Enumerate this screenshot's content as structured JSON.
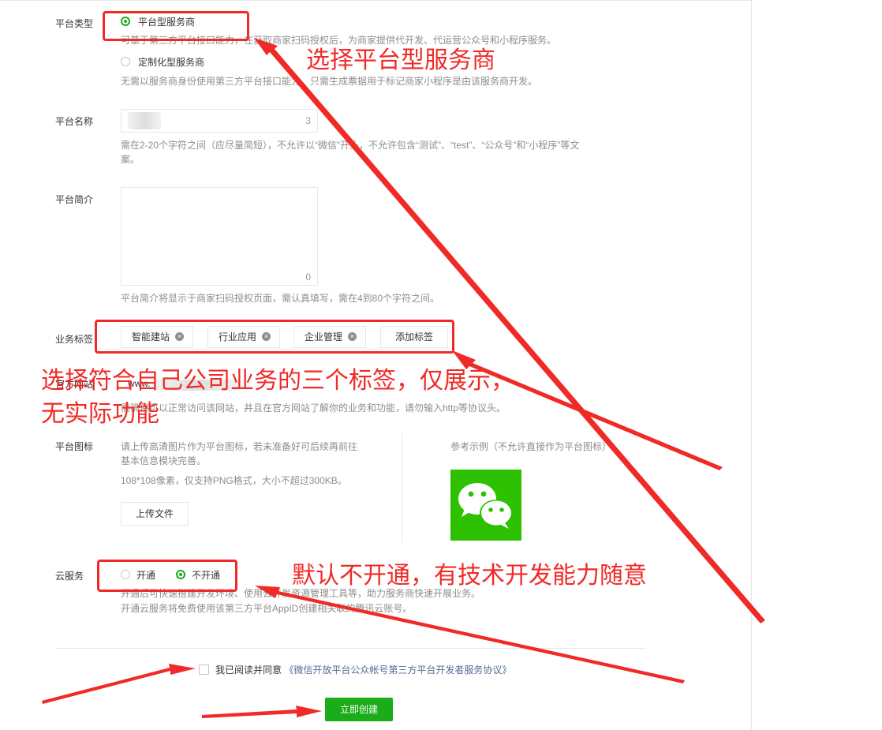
{
  "form": {
    "platform_type": {
      "label": "平台类型",
      "options": [
        {
          "label": "平台型服务商",
          "selected": true,
          "desc": "可基于第三方平台接口能力，在获取商家扫码授权后，为商家提供代开发、代运营公众号和小程序服务。"
        },
        {
          "label": "定制化型服务商",
          "selected": false,
          "desc": "无需以服务商身份使用第三方平台接口能力，只需生成票据用于标记商家小程序是由该服务商开发。"
        }
      ]
    },
    "platform_name": {
      "label": "平台名称",
      "counter": "3",
      "hint_line1": "需在2-20个字符之间（应尽量简短），不允许以“微信”开头，不允许包含“测试”、“test”、“公众号”和“小程序”等文",
      "hint_line2": "案。"
    },
    "platform_intro": {
      "label": "平台简介",
      "counter": "0",
      "hint": "平台简介将显示于商家扫码授权页面，需认真填写，需在4到80个字符之间。"
    },
    "business_tags": {
      "label": "业务标签",
      "tags": [
        "智能建站",
        "行业应用",
        "企业管理"
      ],
      "add_label": "添加标签"
    },
    "website": {
      "label": "官方网站",
      "value": "www.",
      "hint": "需确保可以正常访问该网站，并且在官方网站了解你的业务和功能，请勿输入http等协议头。"
    },
    "platform_icon": {
      "label": "平台图标",
      "hint_line1": "请上传高清图片作为平台图标，若未准备好可后续再前往",
      "hint_line2": "基本信息模块完善。",
      "spec": "108*108像素，仅支持PNG格式，大小不超过300KB。",
      "upload_label": "上传文件",
      "example_label": "参考示例（不允许直接作为平台图标）"
    },
    "cloud_service": {
      "label": "云服务",
      "options": [
        {
          "label": "开通",
          "selected": false
        },
        {
          "label": "不开通",
          "selected": true
        }
      ],
      "hint_line1": "开通后可快速搭建开发环境、使用云开发资源管理工具等，助力服务商快速开展业务。",
      "hint_line2": "开通云服务将免费使用该第三方平台AppID创建相关联的腾讯云账号。"
    },
    "agreement": {
      "prefix": "我已阅读并同意",
      "link": "《微信开放平台公众帐号第三方平台开发者服务协议》"
    },
    "submit_label": "立即创建"
  },
  "annotations": {
    "type_note": "选择平台型服务商",
    "tags_note_line1": "选择符合自己公司业务的三个标签，仅展示，",
    "tags_note_line2": "无实际功能",
    "cloud_note": "默认不开通，有技术开发能力随意"
  },
  "colors": {
    "accent_green": "#1aad19",
    "annotation_red": "#f02a26",
    "hint_gray": "#8d8d8d"
  }
}
